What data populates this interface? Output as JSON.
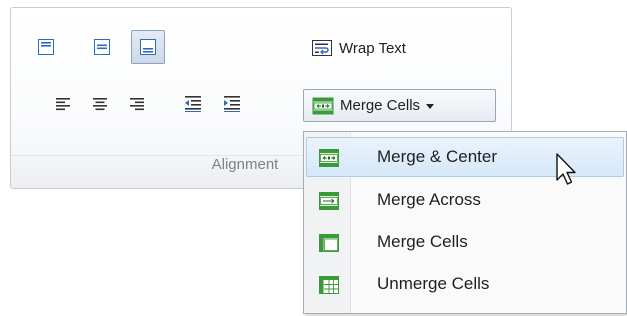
{
  "ribbon": {
    "group_label": "Alignment",
    "wrap_text_label": "Wrap Text",
    "merge_cells_label": "Merge Cells"
  },
  "merge_menu": {
    "items": [
      {
        "label": "Merge & Center",
        "icon": "merge-center-icon",
        "highlighted": true
      },
      {
        "label": "Merge Across",
        "icon": "merge-across-icon",
        "highlighted": false
      },
      {
        "label": "Merge Cells",
        "icon": "merge-cells-icon",
        "highlighted": false
      },
      {
        "label": "Unmerge Cells",
        "icon": "unmerge-cells-icon",
        "highlighted": false
      }
    ]
  },
  "colors": {
    "accent_blue": "#2e6cb8",
    "grid_green": "#3a9a3a",
    "highlight_bg": "#d6e7f8",
    "group_label": "#7d8288"
  }
}
